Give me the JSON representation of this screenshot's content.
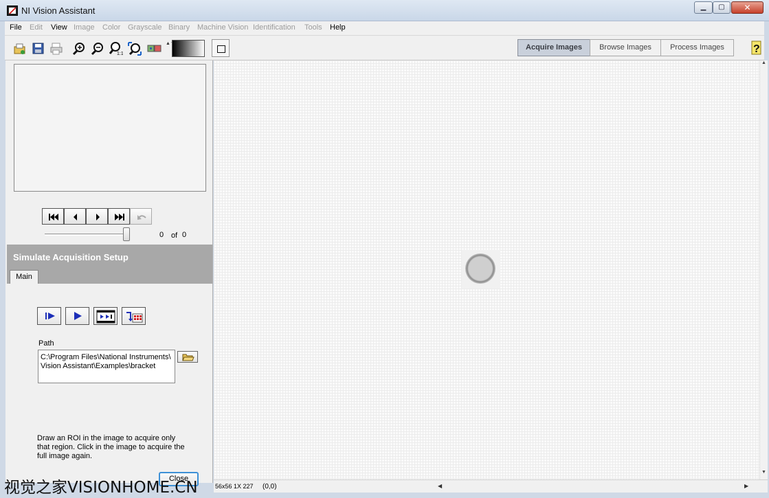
{
  "window": {
    "title": "NI Vision Assistant",
    "min_glyph": "▁",
    "max_glyph": "▢",
    "close_glyph": "✕"
  },
  "menu": [
    "File",
    "Edit",
    "View",
    "Image",
    "Color",
    "Grayscale",
    "Binary",
    "Machine Vision",
    "Identification",
    "Tools",
    "Help"
  ],
  "menu_enabled": [
    true,
    false,
    true,
    false,
    false,
    false,
    false,
    false,
    false,
    false,
    true
  ],
  "toolbar": {
    "icons": [
      "open-image-icon",
      "save-image-icon",
      "print-icon",
      "zoom-in-icon",
      "zoom-out-icon",
      "zoom-1to1-icon",
      "zoom-fit-icon",
      "palette-icon"
    ],
    "ramp_arrows": "▲▼",
    "mode_tabs": [
      "Acquire Images",
      "Browse Images",
      "Process Images"
    ],
    "active_mode": 0,
    "help_glyph": "?"
  },
  "navigator": {
    "current": "0",
    "of": "of",
    "total": "0"
  },
  "setup": {
    "title": "Simulate Acquisition Setup",
    "tab": "Main"
  },
  "acquisition": {
    "path_label": "Path",
    "path_value": "C:\\Program Files\\National Instruments\\\nVision Assistant\\Examples\\bracket",
    "instruction": "Draw an ROI in the image to acquire only that region. Click in the image to acquire the full image again.",
    "close_label": "Close"
  },
  "status": {
    "size": "56x56 1X 227",
    "coords": "(0,0)",
    "scroll_left": "◀",
    "scroll_right": "▶",
    "scroll_up": "▲",
    "scroll_down": "▼"
  },
  "watermark": "视觉之家VISIONHOME.CN"
}
